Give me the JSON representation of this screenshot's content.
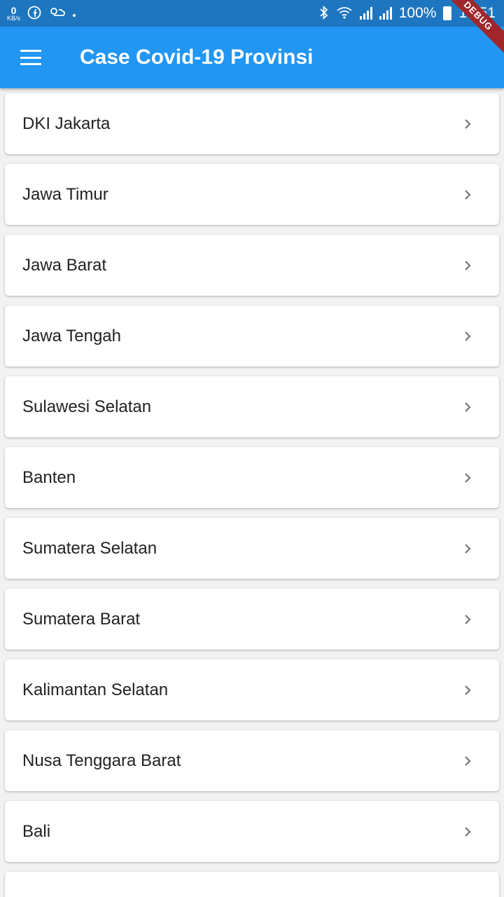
{
  "status_bar": {
    "net_speed_value": "0",
    "net_speed_unit": "KB/s",
    "battery": "100%",
    "time": "18:51",
    "icons": [
      "facebook-icon",
      "weather-icon",
      "dot-icon",
      "bluetooth-icon",
      "wifi-icon",
      "signal-icon",
      "signal-icon",
      "battery-icon"
    ]
  },
  "debug_banner": "DEBUG",
  "appbar": {
    "title": "Case Covid-19 Provinsi",
    "menu_icon": "hamburger-menu-icon"
  },
  "provinces": [
    {
      "label": "DKI Jakarta"
    },
    {
      "label": "Jawa Timur"
    },
    {
      "label": "Jawa Barat"
    },
    {
      "label": "Jawa Tengah"
    },
    {
      "label": "Sulawesi Selatan"
    },
    {
      "label": "Banten"
    },
    {
      "label": "Sumatera Selatan"
    },
    {
      "label": "Sumatera Barat"
    },
    {
      "label": "Kalimantan Selatan"
    },
    {
      "label": "Nusa Tenggara Barat"
    },
    {
      "label": "Bali"
    },
    {
      "label": ""
    }
  ],
  "colors": {
    "appbar": "#2196f3",
    "statusbar": "#1d76bf",
    "background": "#f2f2f2",
    "card": "#ffffff",
    "chevron": "#757575"
  }
}
